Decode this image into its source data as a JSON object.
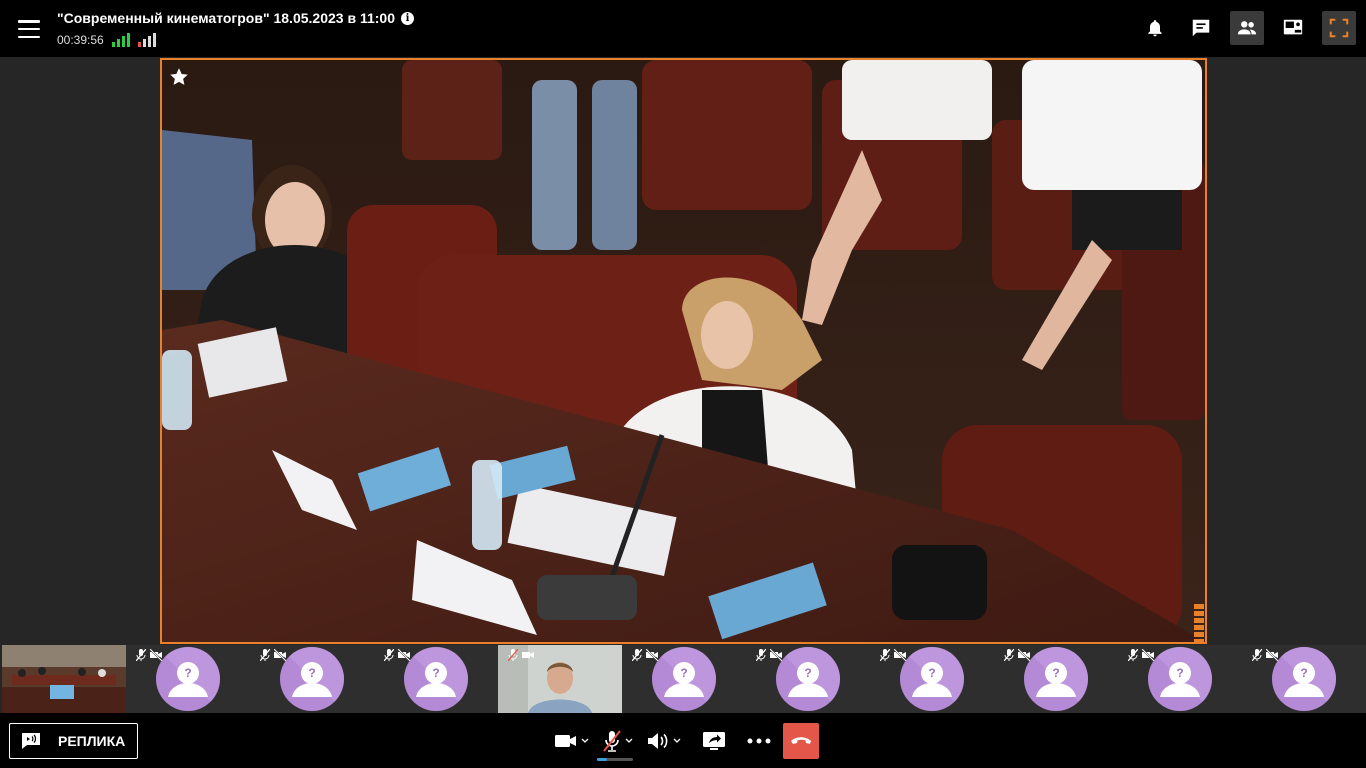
{
  "header": {
    "title": "\"Современный кинематогров\" 18.05.2023 в 11:00",
    "timer": "00:39:56",
    "info_icon": "info-icon",
    "icons": [
      "bell-icon",
      "chat-icon",
      "participants-icon",
      "layout-icon",
      "fullscreen-icon"
    ]
  },
  "colors": {
    "accent": "#e8812a",
    "signal_good": "#2ecc40",
    "avatar_bg": "#b48ad6",
    "end_call": "#e5564a"
  },
  "main_video": {
    "favorite_icon": "star-icon",
    "audio_level": "6 of 6 bars"
  },
  "thumbnails": [
    {
      "type": "video",
      "muted": false
    },
    {
      "type": "avatar",
      "avatar_label": "?",
      "muted": true,
      "camera_off": true
    },
    {
      "type": "avatar",
      "avatar_label": "?",
      "muted": true,
      "camera_off": true
    },
    {
      "type": "avatar",
      "avatar_label": "?",
      "muted": true,
      "camera_off": true
    },
    {
      "type": "video",
      "muted": true,
      "camera_off": true
    },
    {
      "type": "avatar",
      "avatar_label": "?",
      "muted": true,
      "camera_off": true
    },
    {
      "type": "avatar",
      "avatar_label": "?",
      "muted": true,
      "camera_off": true
    },
    {
      "type": "avatar",
      "avatar_label": "?",
      "muted": true,
      "camera_off": true
    },
    {
      "type": "avatar",
      "avatar_label": "?",
      "muted": true,
      "camera_off": true
    },
    {
      "type": "avatar",
      "avatar_label": "?",
      "muted": true,
      "camera_off": true
    },
    {
      "type": "avatar",
      "avatar_label": "?",
      "muted": true,
      "camera_off": true
    }
  ],
  "bottom": {
    "replika_label": "РЕПЛИКА",
    "controls": [
      "camera-icon",
      "microphone-muted-icon",
      "speaker-icon",
      "screen-share-icon",
      "more-icon",
      "end-call-icon"
    ]
  }
}
